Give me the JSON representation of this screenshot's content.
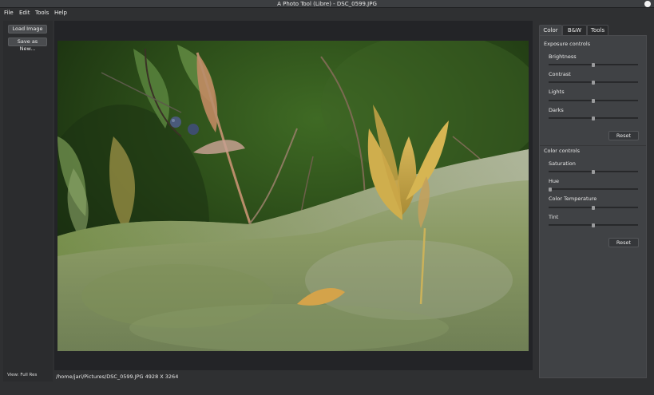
{
  "window": {
    "title": "A Photo Tool (Libre) - DSC_0599.JPG"
  },
  "menubar": {
    "items": [
      "File",
      "Edit",
      "Tools",
      "Help"
    ]
  },
  "sidebar": {
    "load_label": "Load Image",
    "save_label": "Save as New...",
    "view_label": "View: Full Res"
  },
  "statusbar": {
    "path": "/home/jari/Pictures/DSC_0599.JPG 4928 X 3264"
  },
  "panel": {
    "tabs": [
      {
        "label": "Color",
        "active": true
      },
      {
        "label": "B&W",
        "active": false
      },
      {
        "label": "Tools",
        "active": false
      }
    ],
    "exposure": {
      "title": "Exposure controls",
      "sliders": [
        {
          "label": "Brightness",
          "value": 0.5
        },
        {
          "label": "Contrast",
          "value": 0.5
        },
        {
          "label": "Lights",
          "value": 0.5
        },
        {
          "label": "Darks",
          "value": 0.5
        }
      ],
      "reset_label": "Reset"
    },
    "color": {
      "title": "Color controls",
      "sliders": [
        {
          "label": "Saturation",
          "value": 0.5
        },
        {
          "label": "Hue",
          "value": 0.0
        },
        {
          "label": "Color Temperature",
          "value": 0.5
        },
        {
          "label": "Tint",
          "value": 0.5
        }
      ],
      "reset_label": "Reset"
    }
  },
  "colors": {
    "window_bg": "#2f3032",
    "canvas_bg": "#232427",
    "panel_bg": "#404245",
    "accent_text": "#e9e9e9"
  }
}
